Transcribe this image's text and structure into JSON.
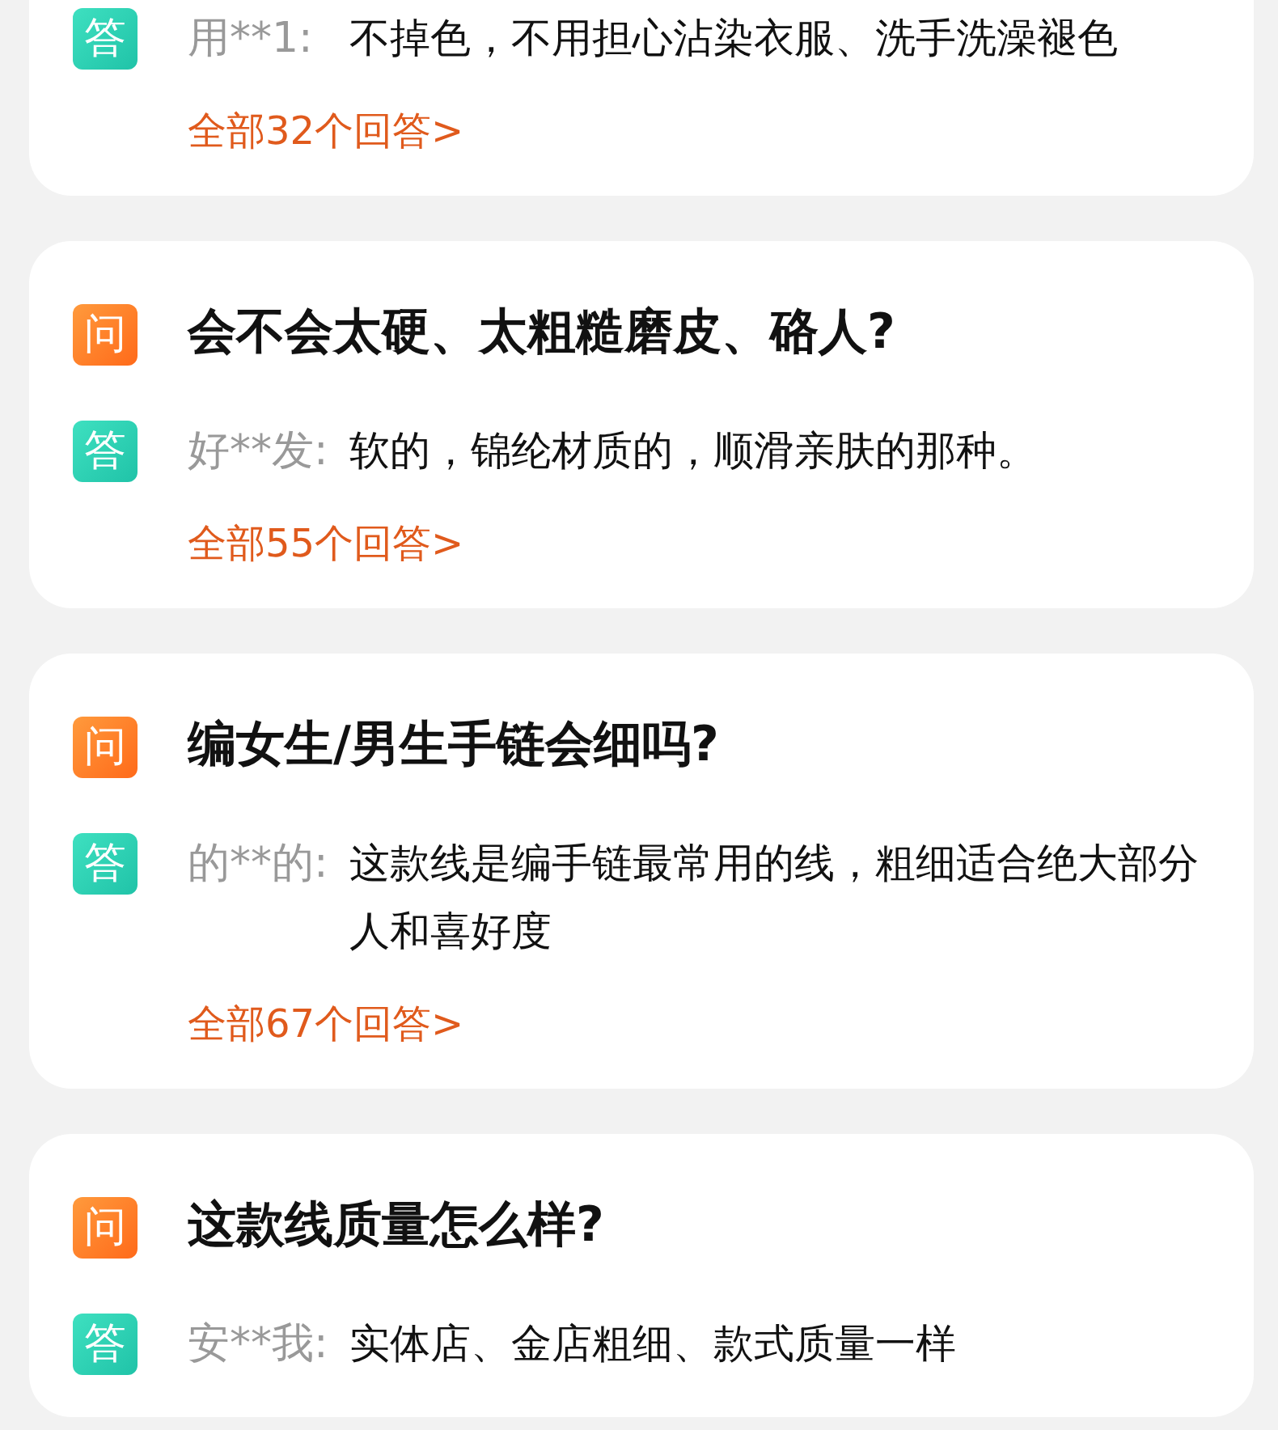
{
  "cards": [
    {
      "answer": {
        "badge": "答",
        "author": "用**1:",
        "text": "不掉色，不用担心沾染衣服、洗手洗澡褪色"
      },
      "more": "全部32个回答>"
    },
    {
      "question": {
        "badge": "问",
        "text": "会不会太硬、太粗糙磨皮、硌人?"
      },
      "answer": {
        "badge": "答",
        "author": "好**发:",
        "text": "软的，锦纶材质的，顺滑亲肤的那种。"
      },
      "more": "全部55个回答>"
    },
    {
      "question": {
        "badge": "问",
        "text": "编女生/男生手链会细吗?"
      },
      "answer": {
        "badge": "答",
        "author": "的**的:",
        "text": "这款线是编手链最常用的线，粗细适合绝大部分人和喜好度"
      },
      "more": "全部67个回答>"
    },
    {
      "question": {
        "badge": "问",
        "text": "这款线质量怎么样?"
      },
      "answer": {
        "badge": "答",
        "author": "安**我:",
        "text": "实体店、金店粗细、款式质量一样"
      }
    }
  ]
}
